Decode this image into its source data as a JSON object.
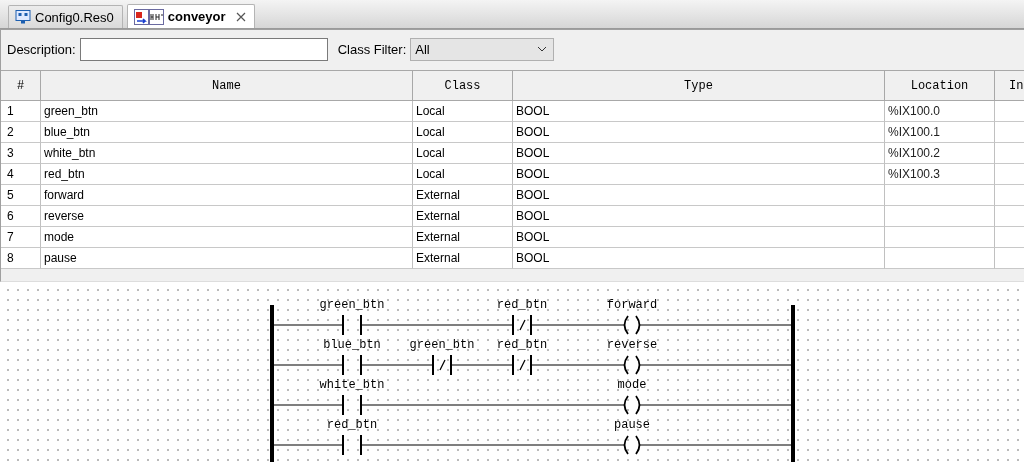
{
  "tabs": [
    {
      "label": "Config0.Res0",
      "selected": false
    },
    {
      "label": "conveyor",
      "selected": true
    }
  ],
  "filter": {
    "description_label": "Description:",
    "class_filter_label": "Class Filter:",
    "class_filter_value": "All"
  },
  "table": {
    "columns": [
      "#",
      "Name",
      "Class",
      "Type",
      "Location",
      "In"
    ],
    "rows": [
      {
        "number": "1",
        "name": "green_btn",
        "class": "Local",
        "type": "BOOL",
        "location": "%IX100.0"
      },
      {
        "number": "2",
        "name": "blue_btn",
        "class": "Local",
        "type": "BOOL",
        "location": "%IX100.1"
      },
      {
        "number": "3",
        "name": "white_btn",
        "class": "Local",
        "type": "BOOL",
        "location": "%IX100.2"
      },
      {
        "number": "4",
        "name": "red_btn",
        "class": "Local",
        "type": "BOOL",
        "location": "%IX100.3"
      },
      {
        "number": "5",
        "name": "forward",
        "class": "External",
        "type": "BOOL"
      },
      {
        "number": "6",
        "name": "reverse",
        "class": "External",
        "type": "BOOL"
      },
      {
        "number": "7",
        "name": "mode",
        "class": "External",
        "type": "BOOL"
      },
      {
        "number": "8",
        "name": "pause",
        "class": "External",
        "type": "BOOL"
      }
    ]
  },
  "ladder": {
    "rungs": [
      {
        "contacts": [
          {
            "label": "green_btn",
            "negated": false
          },
          {
            "label": "red_btn",
            "negated": true
          }
        ],
        "coil": {
          "label": "forward"
        }
      },
      {
        "contacts": [
          {
            "label": "blue_btn",
            "negated": false
          },
          {
            "label": "green_btn",
            "negated": true
          },
          {
            "label": "red_btn",
            "negated": true
          }
        ],
        "coil": {
          "label": "reverse"
        }
      },
      {
        "contacts": [
          {
            "label": "white_btn",
            "negated": false
          }
        ],
        "coil": {
          "label": "mode"
        }
      },
      {
        "contacts": [
          {
            "label": "red_btn",
            "negated": false
          }
        ],
        "coil": {
          "label": "pause"
        }
      }
    ]
  }
}
